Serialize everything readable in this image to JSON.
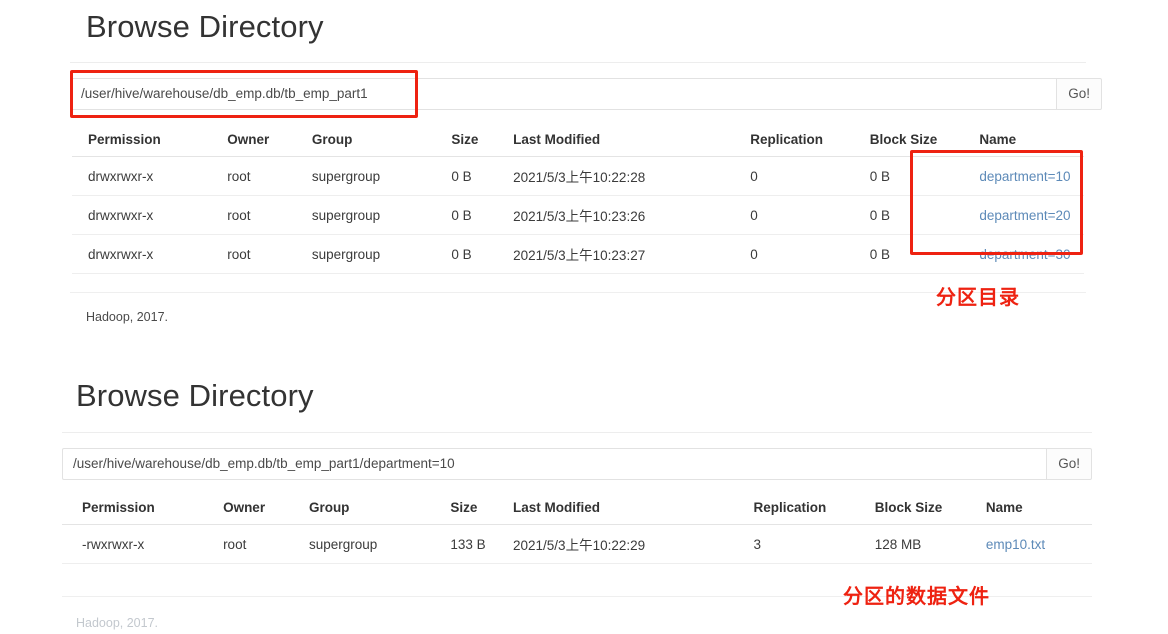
{
  "sections": [
    {
      "title": "Browse Directory",
      "path_input": {
        "value": "/user/hive/warehouse/db_emp.db/tb_emp_part1",
        "placeholder": "Enter a path"
      },
      "go_label": "Go!",
      "columns": [
        "Permission",
        "Owner",
        "Group",
        "Size",
        "Last Modified",
        "Replication",
        "Block Size",
        "Name"
      ],
      "rows": [
        {
          "permission": "drwxrwxr-x",
          "owner": "root",
          "group": "supergroup",
          "size": "0 B",
          "last_modified": "2021/5/3上午10:22:28",
          "replication": "0",
          "block_size": "0 B",
          "name": "department=10"
        },
        {
          "permission": "drwxrwxr-x",
          "owner": "root",
          "group": "supergroup",
          "size": "0 B",
          "last_modified": "2021/5/3上午10:23:26",
          "replication": "0",
          "block_size": "0 B",
          "name": "department=20"
        },
        {
          "permission": "drwxrwxr-x",
          "owner": "root",
          "group": "supergroup",
          "size": "0 B",
          "last_modified": "2021/5/3上午10:23:27",
          "replication": "0",
          "block_size": "0 B",
          "name": "department=30"
        }
      ],
      "footer": "Hadoop, 2017."
    },
    {
      "title": "Browse Directory",
      "path_input": {
        "value": "/user/hive/warehouse/db_emp.db/tb_emp_part1/department=10",
        "placeholder": "Enter a path"
      },
      "go_label": "Go!",
      "columns": [
        "Permission",
        "Owner",
        "Group",
        "Size",
        "Last Modified",
        "Replication",
        "Block Size",
        "Name"
      ],
      "rows": [
        {
          "permission": "-rwxrwxr-x",
          "owner": "root",
          "group": "supergroup",
          "size": "133 B",
          "last_modified": "2021/5/3上午10:22:29",
          "replication": "3",
          "block_size": "128 MB",
          "name": "emp10.txt"
        }
      ],
      "footer": "Hadoop, 2017."
    }
  ],
  "annotations": {
    "color": "#ee2211",
    "partition_dir_label": "分区目录",
    "partition_data_file_label": "分区的数据文件"
  }
}
